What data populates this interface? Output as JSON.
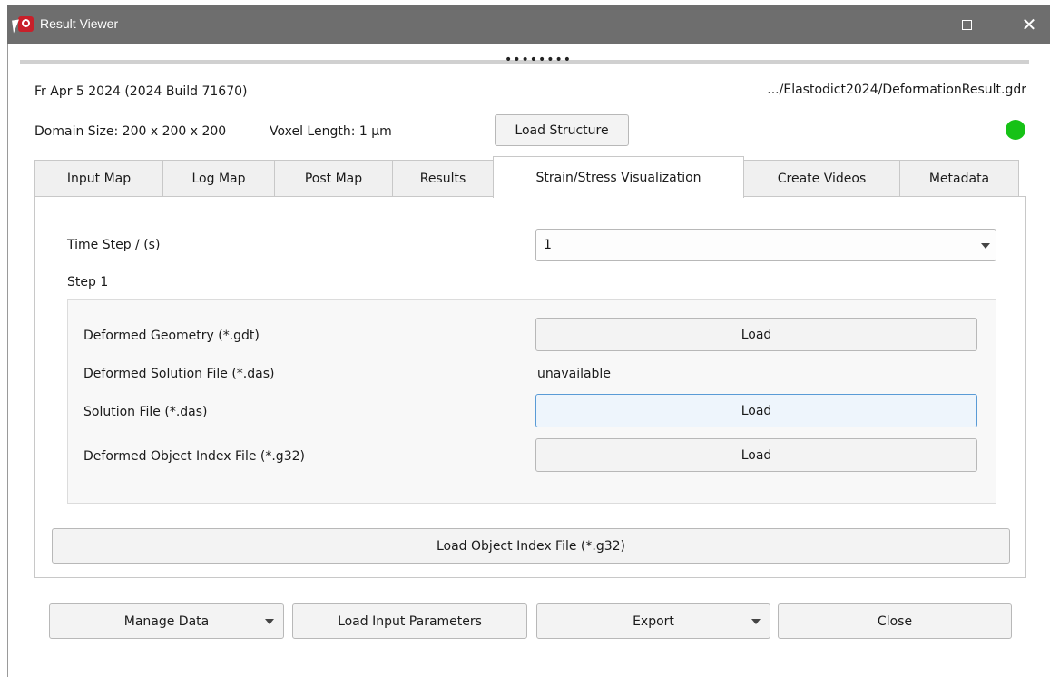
{
  "window": {
    "title": "Result Viewer",
    "minimize_symbol": "",
    "maximize_symbol": "",
    "close_symbol": "✕"
  },
  "header": {
    "build_info": "Fr Apr 5 2024 (2024 Build 71670)",
    "file_path": ".../Elastodict2024/DeformationResult.gdr",
    "domain_size": "Domain Size: 200 x 200 x 200",
    "voxel_length": "Voxel Length: 1 µm",
    "load_structure_label": "Load Structure",
    "status_color": "#16c216"
  },
  "tabs": [
    {
      "label": "Input Map"
    },
    {
      "label": "Log Map"
    },
    {
      "label": "Post Map"
    },
    {
      "label": "Results"
    },
    {
      "label": "Strain/Stress Visualization",
      "active": true
    },
    {
      "label": "Create Videos"
    },
    {
      "label": "Metadata"
    }
  ],
  "panel": {
    "time_step_label": "Time Step / (s)",
    "time_step_value": "1",
    "step_label": "Step 1",
    "rows": [
      {
        "label": "Deformed Geometry (*.gdt)",
        "button": "Load"
      },
      {
        "label": "Deformed Solution File (*.das)",
        "value": "unavailable"
      },
      {
        "label": "Solution File (*.das)",
        "button": "Load"
      },
      {
        "label": "Deformed Object Index File (*.g32)",
        "button": "Load"
      }
    ],
    "load_object_index_label": "Load Object Index File (*.g32)"
  },
  "footer": {
    "manage_data_label": "Manage Data",
    "load_input_params_label": "Load Input Parameters",
    "export_label": "Export",
    "close_label": "Close"
  }
}
